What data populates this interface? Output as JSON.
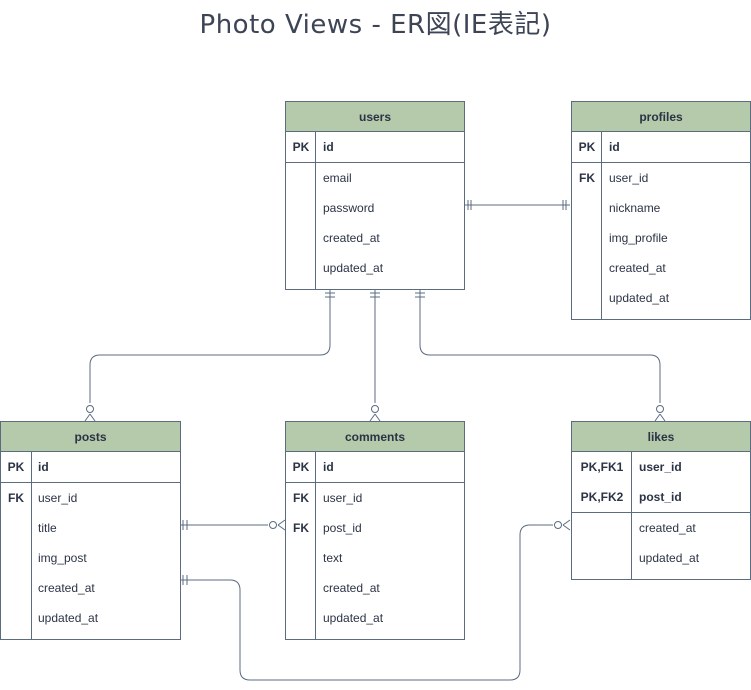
{
  "title": "Photo Views - ER図(IE表記)",
  "entities": {
    "users": {
      "name": "users",
      "pk": [
        {
          "key": "PK",
          "field": "id"
        }
      ],
      "fields": [
        {
          "key": "",
          "field": "email"
        },
        {
          "key": "",
          "field": "password"
        },
        {
          "key": "",
          "field": "created_at"
        },
        {
          "key": "",
          "field": "updated_at"
        }
      ]
    },
    "profiles": {
      "name": "profiles",
      "pk": [
        {
          "key": "PK",
          "field": "id"
        }
      ],
      "fields": [
        {
          "key": "FK",
          "field": "user_id"
        },
        {
          "key": "",
          "field": "nickname"
        },
        {
          "key": "",
          "field": "img_profile"
        },
        {
          "key": "",
          "field": "created_at"
        },
        {
          "key": "",
          "field": "updated_at"
        }
      ]
    },
    "posts": {
      "name": "posts",
      "pk": [
        {
          "key": "PK",
          "field": "id"
        }
      ],
      "fields": [
        {
          "key": "FK",
          "field": "user_id"
        },
        {
          "key": "",
          "field": "title"
        },
        {
          "key": "",
          "field": "img_post"
        },
        {
          "key": "",
          "field": "created_at"
        },
        {
          "key": "",
          "field": "updated_at"
        }
      ]
    },
    "comments": {
      "name": "comments",
      "pk": [
        {
          "key": "PK",
          "field": "id"
        }
      ],
      "fields": [
        {
          "key": "FK",
          "field": "user_id"
        },
        {
          "key": "FK",
          "field": "post_id"
        },
        {
          "key": "",
          "field": "text"
        },
        {
          "key": "",
          "field": "created_at"
        },
        {
          "key": "",
          "field": "updated_at"
        }
      ]
    },
    "likes": {
      "name": "likes",
      "pk": [
        {
          "key": "PK,FK1",
          "field": "user_id"
        },
        {
          "key": "PK,FK2",
          "field": "post_id"
        }
      ],
      "fields": [
        {
          "key": "",
          "field": "created_at"
        },
        {
          "key": "",
          "field": "updated_at"
        }
      ]
    }
  },
  "relationships": [
    {
      "from": "users",
      "to": "profiles",
      "from_card": "one",
      "to_card": "one"
    },
    {
      "from": "users",
      "to": "posts",
      "from_card": "one",
      "to_card": "zero-or-many"
    },
    {
      "from": "users",
      "to": "comments",
      "from_card": "one",
      "to_card": "zero-or-many"
    },
    {
      "from": "users",
      "to": "likes",
      "from_card": "one",
      "to_card": "zero-or-many"
    },
    {
      "from": "posts",
      "to": "comments",
      "from_card": "one",
      "to_card": "zero-or-many"
    },
    {
      "from": "posts",
      "to": "likes",
      "from_card": "one",
      "to_card": "zero-or-many"
    }
  ]
}
